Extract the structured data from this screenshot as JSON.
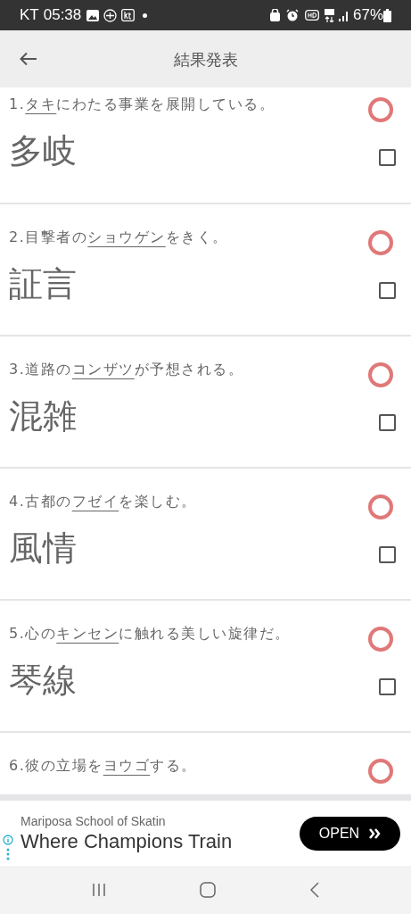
{
  "status_bar": {
    "carrier": "KT",
    "time": "05:38",
    "battery": "67%"
  },
  "header": {
    "title": "結果発表"
  },
  "questions": [
    {
      "before": "1.",
      "underlined": "タキ",
      "after": "にわたる事業を展開している。",
      "correct": true,
      "answer": "多岐",
      "checked": false
    },
    {
      "before": "2.目撃者の",
      "underlined": "ショウゲン",
      "after": "をきく。",
      "correct": true,
      "answer": "証言",
      "checked": false
    },
    {
      "before": "3.道路の",
      "underlined": "コンザツ",
      "after": "が予想される。",
      "correct": true,
      "answer": "混雑",
      "checked": false
    },
    {
      "before": "4.古都の",
      "underlined": "フゼイ",
      "after": "を楽しむ。",
      "correct": true,
      "answer": "風情",
      "checked": false
    },
    {
      "before": "5.心の",
      "underlined": "キンセン",
      "after": "に触れる美しい旋律だ。",
      "correct": true,
      "answer": "琴線",
      "checked": false
    },
    {
      "before": "6.彼の立場を",
      "underlined": "ヨウゴ",
      "after": "する。",
      "correct": true
    }
  ],
  "ad": {
    "advertiser": "Mariposa School of Skatin",
    "headline": "Where Champions Train",
    "button": "OPEN"
  }
}
